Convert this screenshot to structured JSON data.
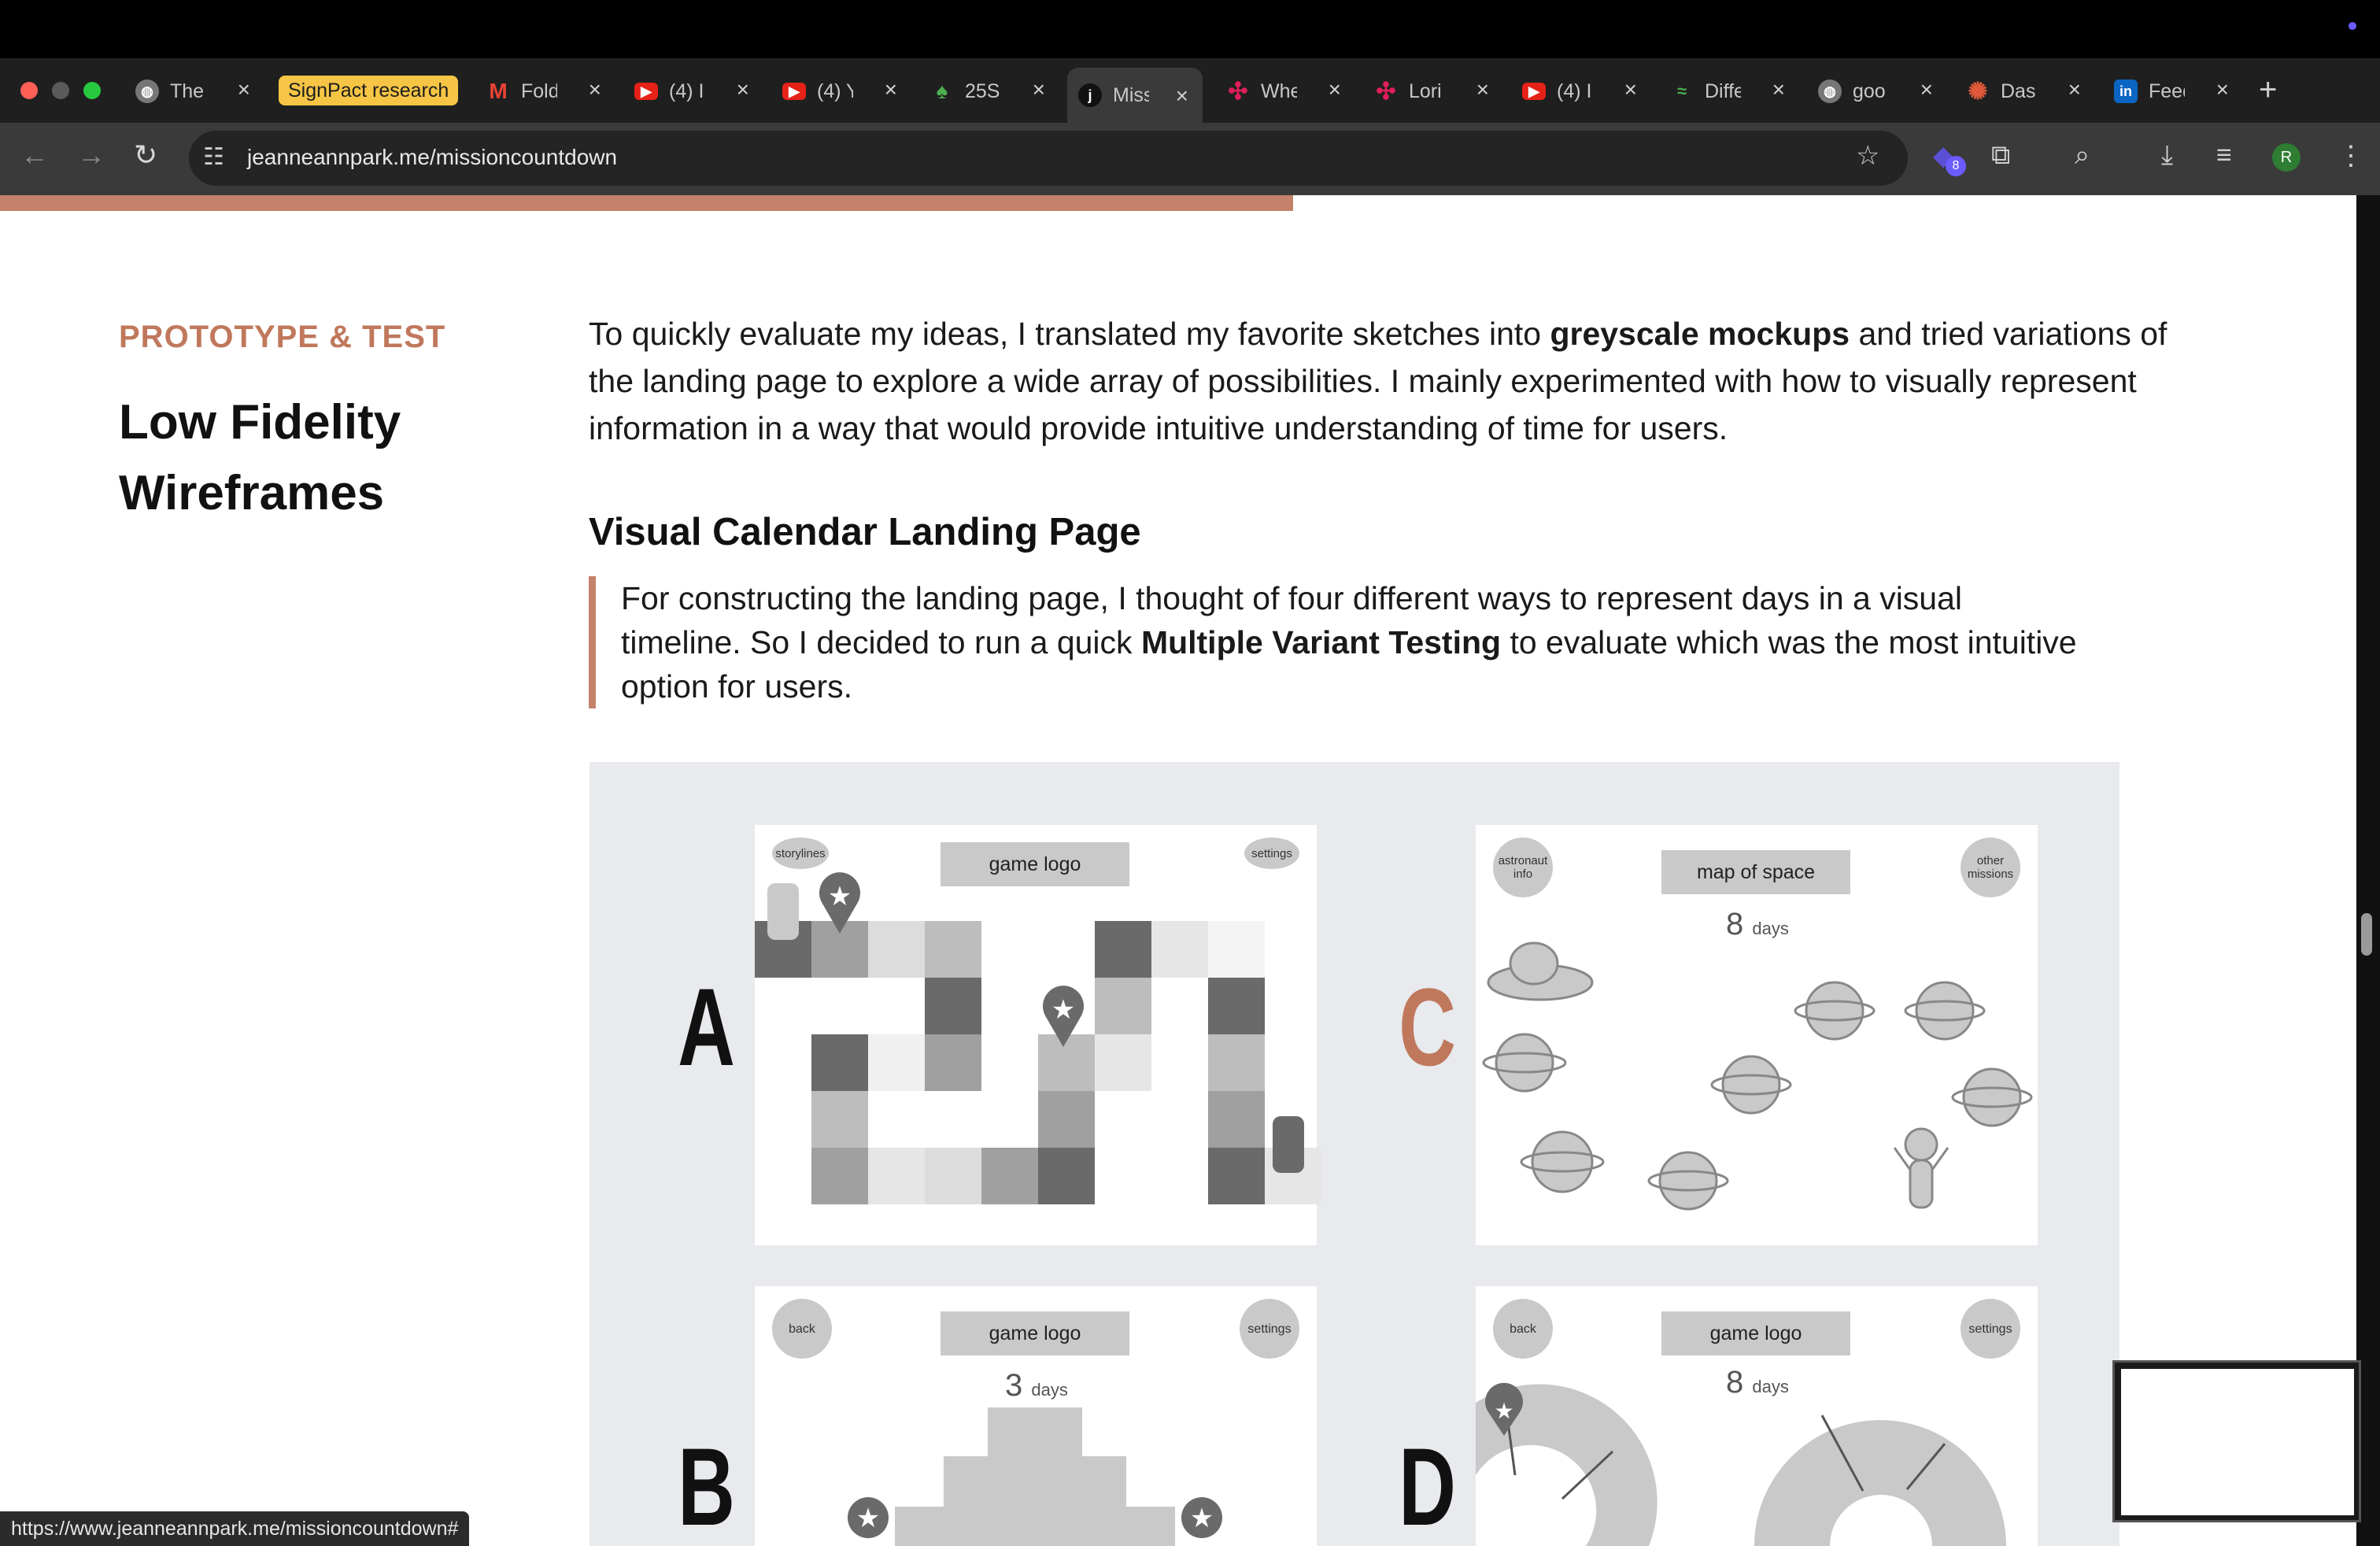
{
  "tabs": [
    {
      "title": "The",
      "icon": "globe-icon"
    },
    {
      "title": "SignPact research",
      "icon": "tab-group-pill"
    },
    {
      "title": "Fold",
      "icon": "gmail-icon"
    },
    {
      "title": "(4) I",
      "icon": "youtube-icon"
    },
    {
      "title": "(4) Y",
      "icon": "youtube-icon"
    },
    {
      "title": "25S",
      "icon": "leaf-icon"
    },
    {
      "title": "Miss",
      "icon": "j-icon",
      "active": true
    },
    {
      "title": "Whe",
      "icon": "slack-icon"
    },
    {
      "title": "Lori",
      "icon": "slack-icon"
    },
    {
      "title": "(4) I",
      "icon": "youtube-icon"
    },
    {
      "title": "Diffe",
      "icon": "diff-icon"
    },
    {
      "title": "goo",
      "icon": "globe-icon"
    },
    {
      "title": "Dasl",
      "icon": "gear-icon"
    },
    {
      "title": "Feed",
      "icon": "linkedin-icon"
    }
  ],
  "toolbar": {
    "url": "jeanneannpark.me/missioncountdown",
    "extension_badge": "8",
    "profile_initial": "R"
  },
  "section": {
    "eyebrow": "PROTOTYPE & TEST",
    "title_line1": "Low Fidelity",
    "title_line2": "Wireframes",
    "intro_a": "To quickly evaluate my ideas, I translated my favorite sketches into ",
    "intro_bold": "greyscale mockups",
    "intro_b": " and tried variations of the landing page to explore a wide array of possibilities. I mainly experimented with how to visually represent information in a way that would provide intuitive understanding of time for users.",
    "subheading": "Visual Calendar Landing Page",
    "quote_a": "For constructing the landing page, I thought of four different ways to represent days in a visual timeline. So I decided to run a quick ",
    "quote_bold": "Multiple Variant Testing",
    "quote_b": " to evaluate which was the most intuitive option for users."
  },
  "wireframes": {
    "A": {
      "letter": "A",
      "logo": "game logo",
      "left_btn": "storylines",
      "right_btn": "settings"
    },
    "B": {
      "letter": "B",
      "logo": "game logo",
      "left_btn": "back",
      "right_btn": "settings",
      "days_num": "3",
      "days_unit": "days"
    },
    "C": {
      "letter": "C",
      "logo": "map of space",
      "left_btn_l1": "astronaut",
      "left_btn_l2": "info",
      "right_btn_l1": "other",
      "right_btn_l2": "missions",
      "days_num": "8",
      "days_unit": "days"
    },
    "D": {
      "letter": "D",
      "logo": "game logo",
      "left_btn": "back",
      "right_btn": "settings",
      "days_num": "8",
      "days_unit": "days"
    }
  },
  "status_url": "https://www.jeanneannpark.me/missioncountdown#",
  "colors": {
    "accent": "#c4826a",
    "eyebrow": "#c0785c",
    "letter_c": "#c0785c"
  }
}
